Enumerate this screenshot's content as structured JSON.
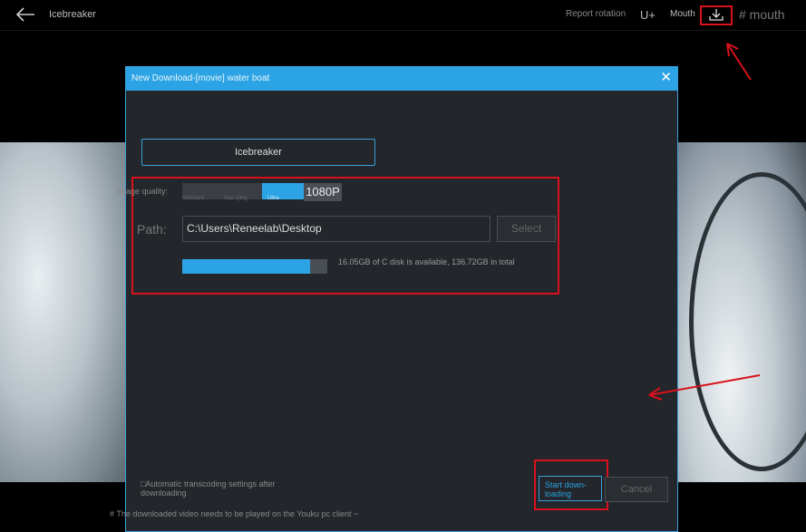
{
  "topbar": {
    "title": "Icebreaker",
    "rotation_label": "Report rotation",
    "u_label": "U+",
    "mouth_label": "Mouth",
    "hash_label": "# mouth"
  },
  "dialog": {
    "title": "New Download-[movie] water boat",
    "close_label": "✕",
    "name_value": "Icebreaker",
    "quality_label": "Image quality:",
    "quality_sub_1": "Standard",
    "quality_sub_2": "Gao Qing",
    "quality_sub_3": "Ultra",
    "quality_1080": "1080P",
    "path_label": "Path:",
    "path_value": "C:\\Users\\Reneelab\\Desktop",
    "select_label": "Select",
    "disk_text": "16.05GB of C disk is available, 136.72GB in total",
    "disk_fraction": 0.88,
    "auto_transcoding": "□Automatic transcoding settings after downloading",
    "start_label": "Start down-loading",
    "cancel_label": "Cancel"
  },
  "footnote": "# The downloaded video needs to be played on the Youku pc client ~",
  "colors": {
    "accent": "#2ba3e4",
    "annotation_red": "#d9111b"
  }
}
